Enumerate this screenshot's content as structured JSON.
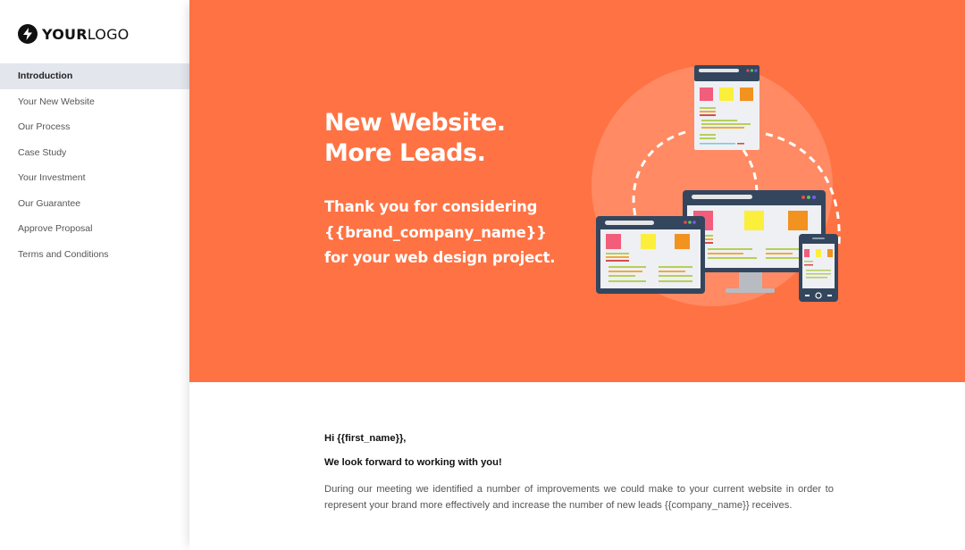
{
  "logo": {
    "bold": "YOUR",
    "light": "LOGO",
    "icon": "lightning-bolt-icon"
  },
  "sidebar": {
    "items": [
      {
        "label": "Introduction",
        "active": true
      },
      {
        "label": "Your New Website",
        "active": false
      },
      {
        "label": "Our Process",
        "active": false
      },
      {
        "label": "Case Study",
        "active": false
      },
      {
        "label": "Your Investment",
        "active": false
      },
      {
        "label": "Our Guarantee",
        "active": false
      },
      {
        "label": "Approve Proposal",
        "active": false
      },
      {
        "label": "Terms and Conditions",
        "active": false
      }
    ]
  },
  "hero": {
    "title_line1": "New Website.",
    "title_line2": "More Leads.",
    "subtitle_line1": "Thank you for considering",
    "subtitle_line2": "{{brand_company_name}}",
    "subtitle_line3": "for your web design project.",
    "background_color": "#ff7243",
    "illustration": "responsive-devices-illustration"
  },
  "content": {
    "greeting": "Hi {{first_name}},",
    "lead": "We look forward to working with you!",
    "paragraph": "During our meeting we identified a number of improvements we could make to your current website in order to represent your brand more effectively and increase the number of new leads {{company_name}} receives."
  }
}
